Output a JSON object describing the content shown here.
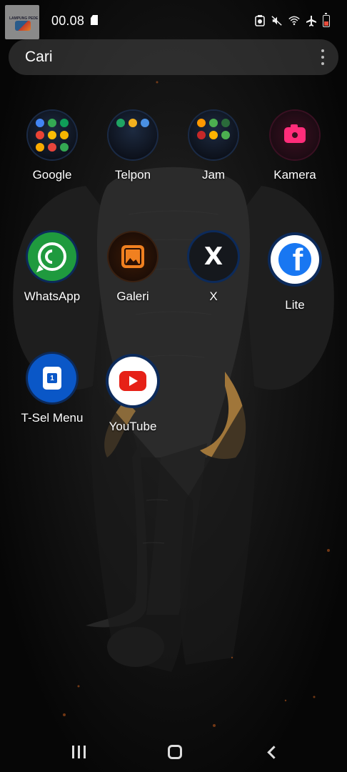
{
  "status_bar": {
    "time": "00.08",
    "icons": [
      "gallery-thumbnail-icon",
      "sim-card-icon",
      "battery-saver-icon",
      "mute-icon",
      "wifi-icon",
      "airplane-icon",
      "battery-low-icon"
    ],
    "thumbnail_text": "LAMPUNG PEDE"
  },
  "search": {
    "label": "Cari",
    "menu_icon": "more-vert-icon"
  },
  "apps": [
    {
      "label": "Google",
      "icon": "google-folder-icon"
    },
    {
      "label": "Telpon",
      "icon": "phone-folder-icon"
    },
    {
      "label": "Jam",
      "icon": "clock-folder-icon"
    },
    {
      "label": "Kamera",
      "icon": "camera-icon"
    },
    {
      "label": "WhatsApp",
      "icon": "whatsapp-icon"
    },
    {
      "label": "Galeri",
      "icon": "gallery-icon"
    },
    {
      "label": "X",
      "icon": "x-icon"
    },
    {
      "label": "Lite",
      "icon": "facebook-lite-icon"
    },
    {
      "label": "T-Sel Menu",
      "icon": "tsel-sim-icon"
    },
    {
      "label": "YouTube",
      "icon": "youtube-icon"
    }
  ],
  "folder_colors": {
    "google": [
      "#4285F4",
      "#34A853",
      "#0F9D58",
      "#EA4335",
      "#FBBC05",
      "#F4B400",
      "#F9AB00",
      "#E8453C",
      "#34A853"
    ],
    "telpon": [
      "#1fa463",
      "#f2b01e",
      "#4a90e2"
    ],
    "jam": [
      "#ff9800",
      "#4caf50",
      "#2a6b3a",
      "#c62828",
      "#ffb300",
      "#4caf50"
    ]
  },
  "x_glyph": "X",
  "fb_glyph": "f",
  "tsel_glyph": "1",
  "nav": {
    "icons": [
      "recents-icon",
      "home-icon",
      "back-icon"
    ]
  }
}
